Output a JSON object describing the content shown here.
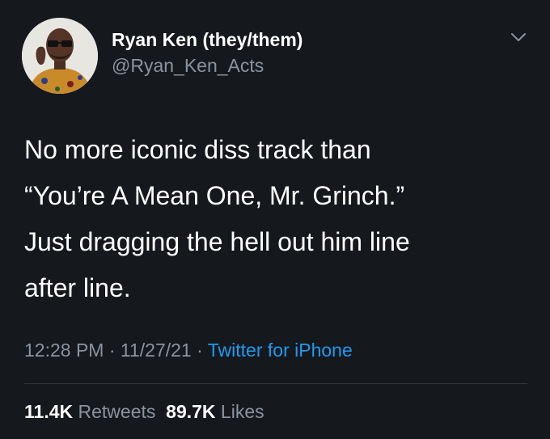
{
  "author": {
    "name": "Ryan Ken (they/them)",
    "handle": "@Ryan_Ken_Acts"
  },
  "tweet": {
    "lines": [
      "No more iconic diss track than",
      "“You’re A Mean One, Mr. Grinch.”",
      "Just dragging the hell out him line",
      "after line."
    ]
  },
  "meta": {
    "time": "12:28 PM",
    "sep1": " · ",
    "date": "11/27/21",
    "sep2": " · ",
    "source": "Twitter for iPhone"
  },
  "stats": {
    "retweets_count": "11.4K",
    "retweets_label": "Retweets",
    "likes_count": "89.7K",
    "likes_label": "Likes"
  },
  "icons": {
    "menu": "chevron-down-icon"
  },
  "colors": {
    "background": "#15181d",
    "primary_text": "#ffffff",
    "secondary_text": "#8a949e",
    "link": "#1d9bf0",
    "divider": "#2f3336"
  }
}
